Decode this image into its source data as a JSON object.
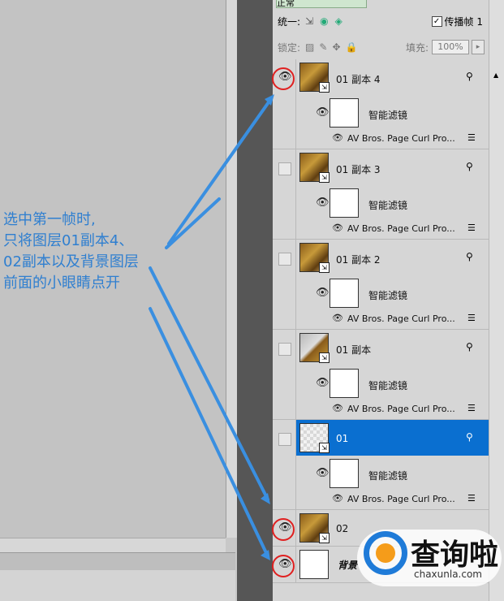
{
  "panel": {
    "blend_mode": "正常",
    "unify_label": "统一:",
    "propagate_label": "传播帧 1",
    "lock_label": "锁定:",
    "fill_label": "填充:",
    "fill_value": "100%"
  },
  "layers": [
    {
      "name": "01 副本 4",
      "visible": true,
      "thumb": "photo",
      "filter_label": "智能滤镜",
      "effect": "AV Bros. Page Curl Pro..."
    },
    {
      "name": "01 副本 3",
      "visible": false,
      "thumb": "photo",
      "filter_label": "智能滤镜",
      "effect": "AV Bros. Page Curl Pro..."
    },
    {
      "name": "01 副本 2",
      "visible": false,
      "thumb": "photo",
      "filter_label": "智能滤镜",
      "effect": "AV Bros. Page Curl Pro..."
    },
    {
      "name": "01 副本",
      "visible": false,
      "thumb": "partial",
      "filter_label": "智能滤镜",
      "effect": "AV Bros. Page Curl Pro..."
    },
    {
      "name": "01",
      "visible": false,
      "thumb": "checker",
      "selected": true,
      "filter_label": "智能滤镜",
      "effect": "AV Bros. Page Curl Pro..."
    },
    {
      "name": "02",
      "visible": true,
      "thumb": "photo"
    },
    {
      "name": "背景",
      "visible": true,
      "thumb": "white"
    }
  ],
  "annotation": {
    "lines": [
      "选中第一帧时,",
      "只将图层01副本4、",
      "02副本以及背景图层",
      "前面的小眼睛点开"
    ]
  },
  "watermark": {
    "text": "查询啦",
    "url": "chaxunla.com"
  },
  "colors": {
    "selected": "#0a6fd0",
    "annotation": "#2f7fd0",
    "circle": "#e02020"
  }
}
